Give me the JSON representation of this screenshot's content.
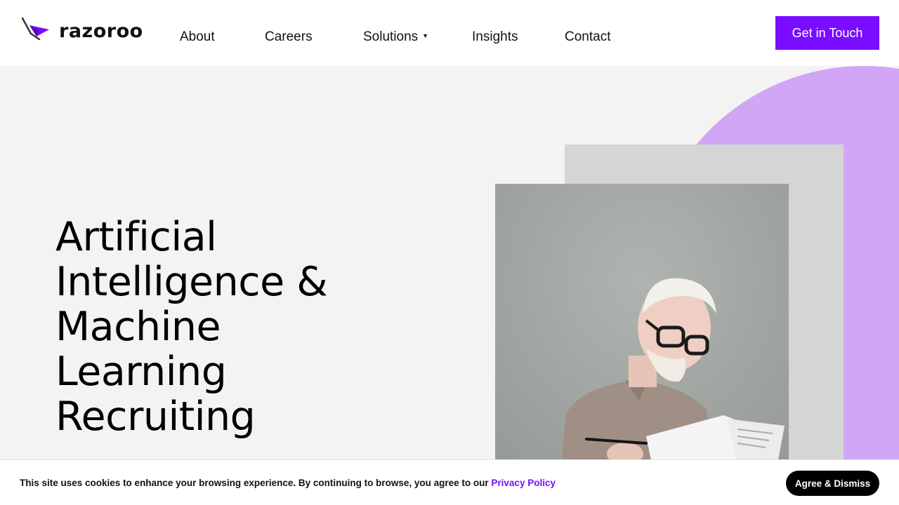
{
  "header": {
    "logo_text": "razoroo",
    "nav": [
      {
        "label": "About"
      },
      {
        "label": "Careers"
      },
      {
        "label": "Solutions",
        "has_dropdown": true
      },
      {
        "label": "Insights"
      },
      {
        "label": "Contact"
      }
    ],
    "cta_label": "Get in Touch"
  },
  "hero": {
    "headline_lines": [
      "Artificial",
      "Intelligence &",
      "Machine",
      "Learning",
      "Recruiting"
    ],
    "image_icon": "person-reading-document-photo"
  },
  "cookie_banner": {
    "text": "This site uses cookies to enhance your browsing experience. By continuing to browse, you agree to our ",
    "link_label": "Privacy Policy",
    "button_label": "Agree & Dismiss"
  },
  "colors": {
    "accent": "#7a0cff",
    "hero_background": "#f3f3f3",
    "arc": "#d0a6f5",
    "card": "#d5d5d5",
    "cookie_button": "#000000"
  }
}
